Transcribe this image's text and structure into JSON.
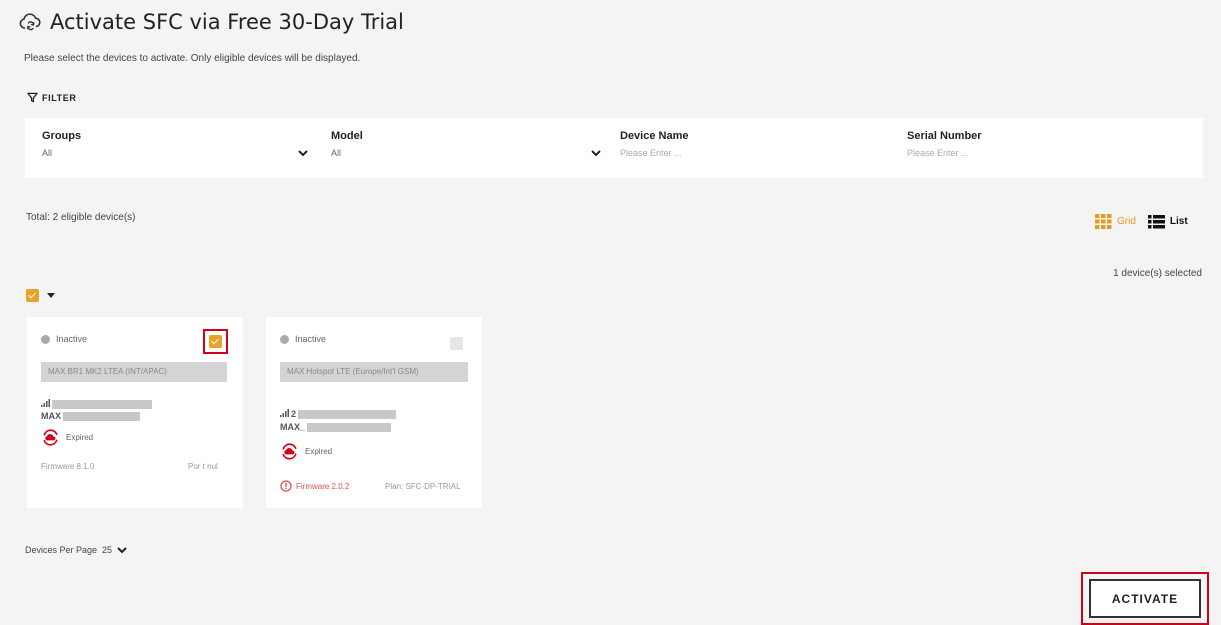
{
  "page": {
    "title": "Activate SFC via Free 30-Day Trial",
    "subtitle": "Please select the devices to activate. Only eligible devices will be displayed.",
    "title_icon": "cloud-refresh-icon"
  },
  "filter": {
    "heading": "FILTER",
    "groups": {
      "label": "Groups",
      "value": "All"
    },
    "model": {
      "label": "Model",
      "value": "All"
    },
    "device_name": {
      "label": "Device Name",
      "placeholder": "Please Enter ..."
    },
    "serial_number": {
      "label": "Serial Number",
      "placeholder": "Please Enter ..."
    }
  },
  "summary": {
    "total": "Total: 2 eligible device(s)",
    "selected": "1 device(s) selected"
  },
  "view_toggle": {
    "grid_label": "Grid",
    "list_label": "List",
    "active": "grid"
  },
  "select_all": {
    "checked": true
  },
  "devices": [
    {
      "status": "Inactive",
      "selected": true,
      "model": "MAX BR1 MK2 LTEA (INT/APAC)",
      "signal_prefix": "",
      "name_prefix": "MAX",
      "license_status": "Expired",
      "firmware": "Firmware 8.1.0",
      "extra": "Por t nul"
    },
    {
      "status": "Inactive",
      "selected": false,
      "model": "MAX Hotspot LTE (Europe/Int'l GSM)",
      "signal_prefix": "2",
      "name_prefix": "MAX_",
      "license_status": "Expired",
      "firmware": "Firmware 2.0.2",
      "extra": "Plan: SFC-DP-TRIAL"
    }
  ],
  "pagination": {
    "label": "Devices Per Page",
    "value": "25"
  },
  "actions": {
    "activate_label": "ACTIVATE"
  },
  "colors": {
    "accent": "#e8a32a",
    "highlight": "#d0021b",
    "expired_red": "#d0021b",
    "background": "#f4f4f4"
  }
}
